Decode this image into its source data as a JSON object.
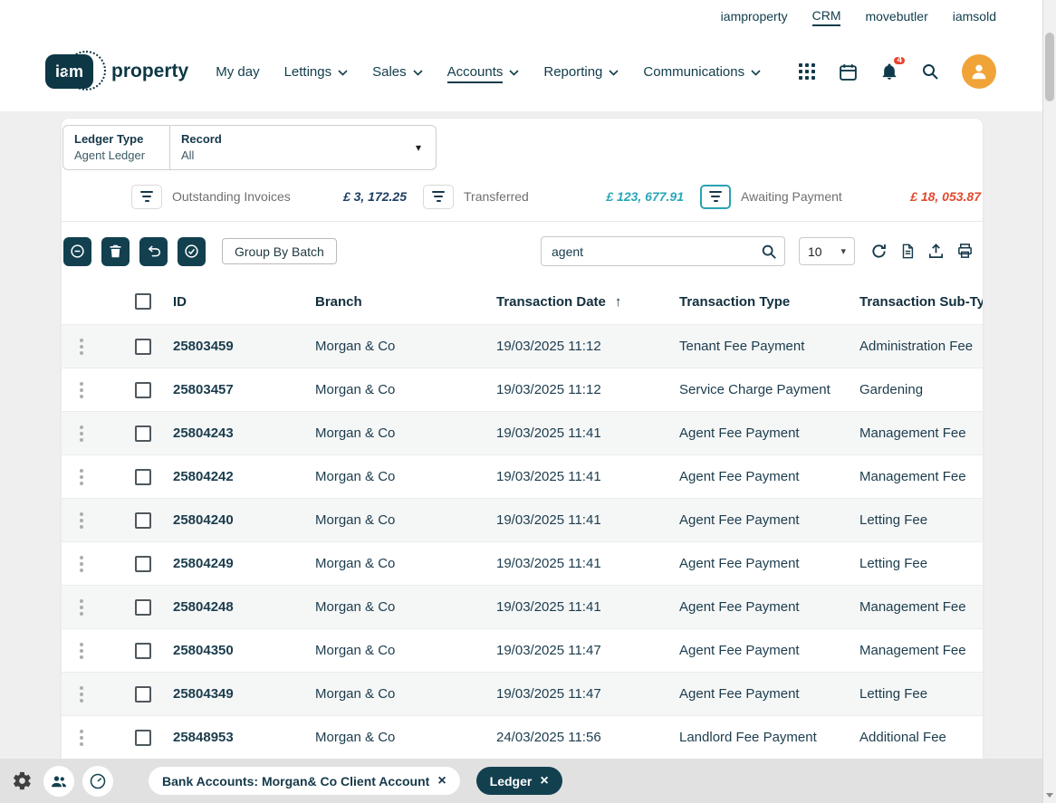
{
  "top_bar": {
    "links": [
      {
        "label": "iamproperty",
        "active": false
      },
      {
        "label": "CRM",
        "active": true
      },
      {
        "label": "movebutler",
        "active": false
      },
      {
        "label": "iamsold",
        "active": false
      }
    ]
  },
  "header": {
    "logo": {
      "mark": "iam",
      "text": "property"
    },
    "nav": [
      {
        "label": "My day",
        "dropdown": false,
        "active": false
      },
      {
        "label": "Lettings",
        "dropdown": true,
        "active": false
      },
      {
        "label": "Sales",
        "dropdown": true,
        "active": false
      },
      {
        "label": "Accounts",
        "dropdown": true,
        "active": true
      },
      {
        "label": "Reporting",
        "dropdown": true,
        "active": false
      },
      {
        "label": "Communications",
        "dropdown": true,
        "active": false
      }
    ],
    "notification_badge": "4"
  },
  "filter_control": {
    "ledger_type": {
      "label": "Ledger Type",
      "value": "Agent Ledger"
    },
    "record": {
      "label": "Record",
      "value": "All"
    }
  },
  "summary": [
    {
      "label": "Outstanding Invoices",
      "amount": "£ 3, 172.25",
      "amount_color": "#1d3f63",
      "filter_active": false
    },
    {
      "label": "Transferred",
      "amount": "£ 123, 677.91",
      "amount_color": "#2aa7b8",
      "filter_active": false
    },
    {
      "label": "Awaiting Payment",
      "amount": "£ 18, 053.87",
      "amount_color": "#e2492f",
      "filter_active": true
    }
  ],
  "toolbar": {
    "group_by_batch_label": "Group By Batch",
    "search_value": "agent",
    "page_size": "10"
  },
  "table": {
    "headers": {
      "id": "ID",
      "branch": "Branch",
      "transaction_date": "Transaction Date",
      "transaction_type": "Transaction Type",
      "transaction_subtype": "Transaction Sub-Type"
    },
    "rows": [
      {
        "id": "25803459",
        "branch": "Morgan & Co",
        "date": "19/03/2025 11:12",
        "type": "Tenant Fee Payment",
        "subtype": "Administration Fee"
      },
      {
        "id": "25803457",
        "branch": "Morgan & Co",
        "date": "19/03/2025 11:12",
        "type": "Service Charge Payment",
        "subtype": "Gardening"
      },
      {
        "id": "25804243",
        "branch": "Morgan & Co",
        "date": "19/03/2025 11:41",
        "type": "Agent Fee Payment",
        "subtype": "Management Fee"
      },
      {
        "id": "25804242",
        "branch": "Morgan & Co",
        "date": "19/03/2025 11:41",
        "type": "Agent Fee Payment",
        "subtype": "Management Fee"
      },
      {
        "id": "25804240",
        "branch": "Morgan & Co",
        "date": "19/03/2025 11:41",
        "type": "Agent Fee Payment",
        "subtype": "Letting Fee"
      },
      {
        "id": "25804249",
        "branch": "Morgan & Co",
        "date": "19/03/2025 11:41",
        "type": "Agent Fee Payment",
        "subtype": "Letting Fee"
      },
      {
        "id": "25804248",
        "branch": "Morgan & Co",
        "date": "19/03/2025 11:41",
        "type": "Agent Fee Payment",
        "subtype": "Management Fee"
      },
      {
        "id": "25804350",
        "branch": "Morgan & Co",
        "date": "19/03/2025 11:47",
        "type": "Agent Fee Payment",
        "subtype": "Management Fee"
      },
      {
        "id": "25804349",
        "branch": "Morgan & Co",
        "date": "19/03/2025 11:47",
        "type": "Agent Fee Payment",
        "subtype": "Letting Fee"
      },
      {
        "id": "25848953",
        "branch": "Morgan & Co",
        "date": "24/03/2025 11:56",
        "type": "Landlord Fee Payment",
        "subtype": "Additional Fee"
      }
    ]
  },
  "bottom_bar": {
    "tabs": [
      {
        "label": "Bank Accounts: Morgan& Co Client Account",
        "active": false
      },
      {
        "label": "Ledger",
        "active": true
      }
    ]
  },
  "glyphs": {
    "caret_down": "▾",
    "close": "×",
    "sort_asc": "↑"
  },
  "colors": {
    "brand_dark": "#12404f",
    "teal": "#2aa7b8",
    "red": "#e2492f",
    "avatar": "#f0a437",
    "badge": "#e8432e"
  }
}
